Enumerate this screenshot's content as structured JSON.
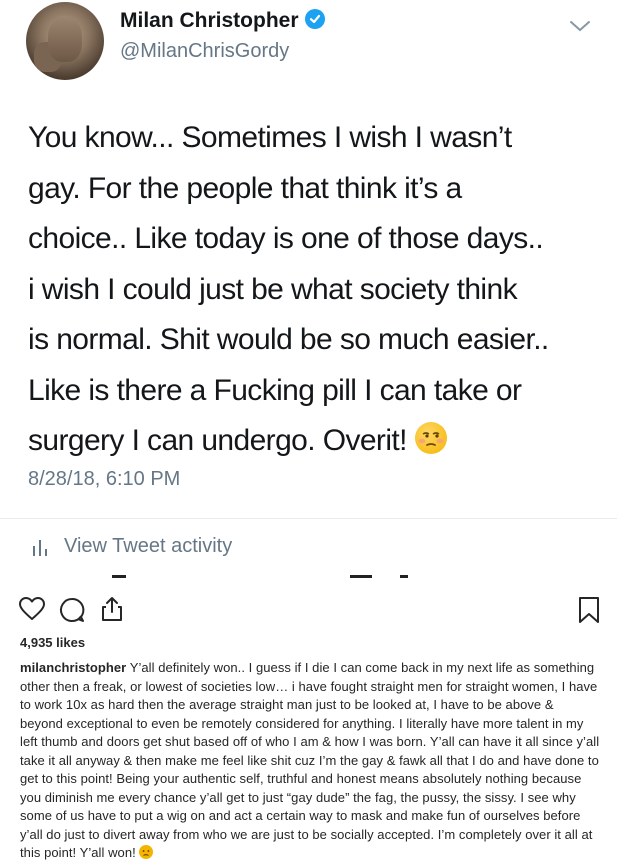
{
  "tweet": {
    "display_name": "Milan Christopher",
    "handle": "@MilanChrisGordy",
    "lines": [
      "You know... Sometimes I wish I wasn’t",
      "gay. For the people that think it’s a",
      "choice.. Like today is one of those days..",
      "i wish I could just be what society think",
      "is normal. Shit would be so much easier..",
      "Like is there a Fucking pill I can take or",
      "surgery I can undergo. Overit!"
    ],
    "timestamp": "8/28/18, 6:10 PM",
    "activity_label": "View Tweet activity",
    "colors": {
      "verified": "#1da1f2",
      "secondary": "#657786"
    }
  },
  "post": {
    "likes": "4,935 likes",
    "username": "milanchristopher",
    "caption": "Y’all definitely won.. I guess if I die I can come back in my next life as something other then a freak, or lowest of societies low… i have fought straight men for straight women, I have to work 10x as hard then the average straight man just to be looked at, I have to be above & beyond exceptional to even be remotely considered for anything. I literally have more talent in my left thumb and doors get shut based off of who I am & how I was born. Y’all can have it all since y’all take it all anyway & then make me feel like shit cuz I’m the gay & fawk all that I do and have done to get to this point! Being your authentic self, truthful and honest means absolutely nothing because you diminish me every chance y’all get to just “gay dude” the fag, the pussy, the sissy. I see why some of us have to put a wig on and act a certain way to mask and make fun of ourselves before y’all do just to divert away from who we are just to be socially accepted. I’m completely over it all at this point! Y’all won!"
  }
}
